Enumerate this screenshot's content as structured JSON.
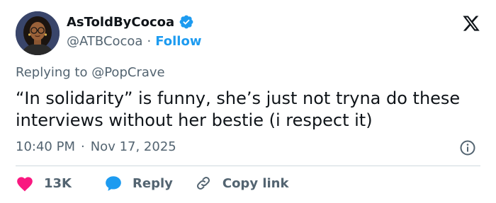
{
  "author": {
    "display_name": "AsToldByCocoa",
    "handle": "@ATBCocoa",
    "separator": "·",
    "follow_label": "Follow",
    "verified": true
  },
  "reply_context": {
    "prefix": "Replying to",
    "mention": "@PopCrave"
  },
  "tweet": {
    "text": "“In solidarity” is funny, she’s just not tryna do these interviews without her bestie (i respect it)",
    "time": "10:40 PM",
    "separator": "·",
    "date": "Nov 17, 2025"
  },
  "actions": {
    "like_count": "13K",
    "reply_label": "Reply",
    "copy_link_label": "Copy link"
  },
  "icons": {
    "x_logo": "x-logo-icon",
    "verified": "verified-badge-icon",
    "info": "info-icon",
    "like": "heart-icon",
    "reply": "speech-bubble-icon",
    "copy": "link-icon"
  },
  "colors": {
    "accent": "#1d9bf0",
    "like": "#f91880",
    "text": "#0f1419",
    "muted": "#536471",
    "divider": "#cfd9de"
  }
}
